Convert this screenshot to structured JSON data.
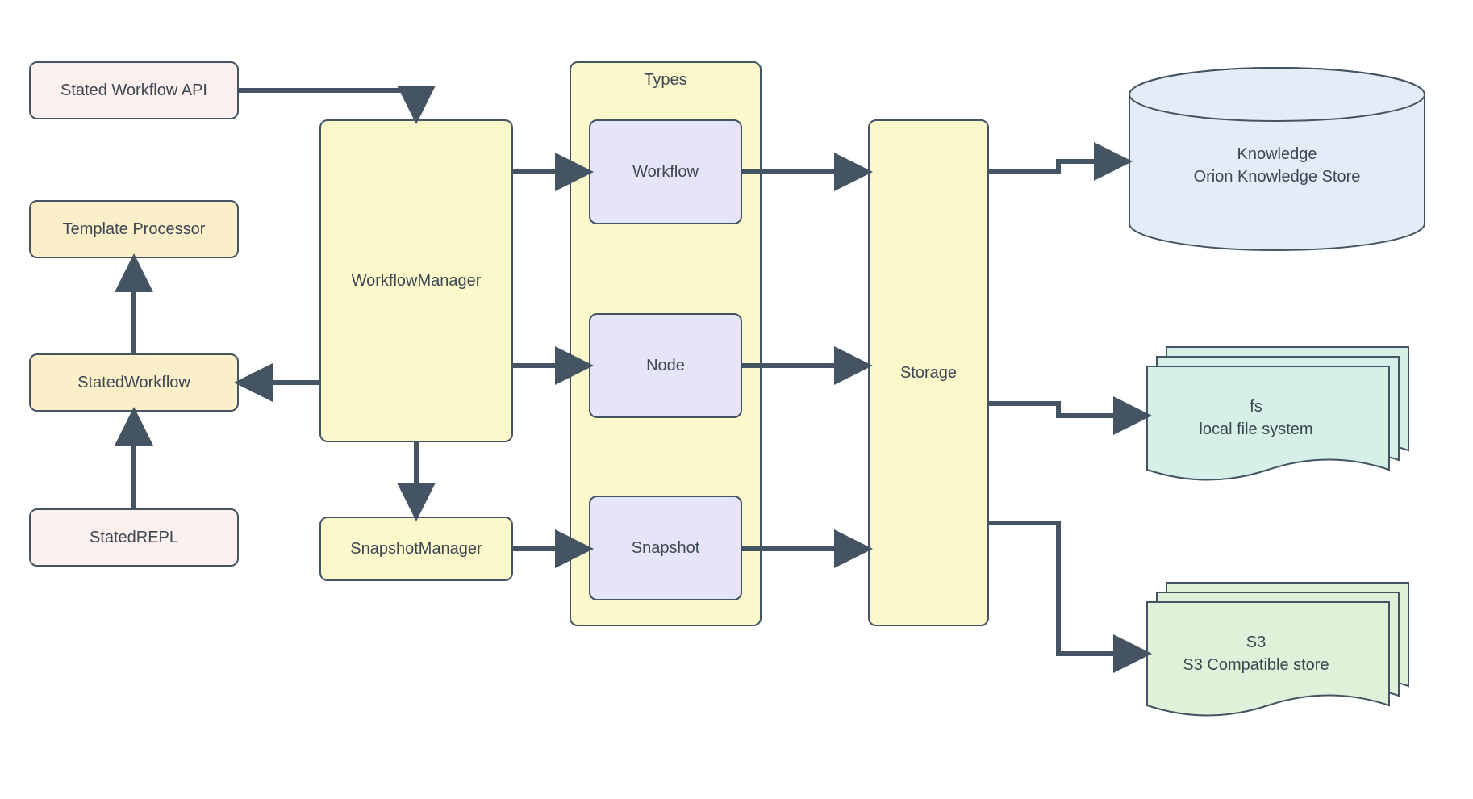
{
  "nodes": {
    "stated_workflow_api": "Stated Workflow API",
    "template_processor": "Template Processor",
    "stated_workflow": "StatedWorkflow",
    "stated_repl": "StatedREPL",
    "workflow_manager": "WorkflowManager",
    "snapshot_manager": "SnapshotManager",
    "types_title": "Types",
    "type_workflow": "Workflow",
    "type_node": "Node",
    "type_snapshot": "Snapshot",
    "storage": "Storage",
    "knowledge_line1": "Knowledge",
    "knowledge_line2": "Orion Knowledge Store",
    "fs_line1": "fs",
    "fs_line2": "local file system",
    "s3_line1": "S3",
    "s3_line2": "S3 Compatible store"
  },
  "colors": {
    "pink": "#fcf0ee",
    "beige": "#fbefca",
    "yellow": "#fbf8cc",
    "purple": "#e5e5f7",
    "teal": "#d6f0e7",
    "green": "#e0f1d9",
    "blue": "#e4ecf7",
    "border": "#445463",
    "text": "#3d4752"
  }
}
